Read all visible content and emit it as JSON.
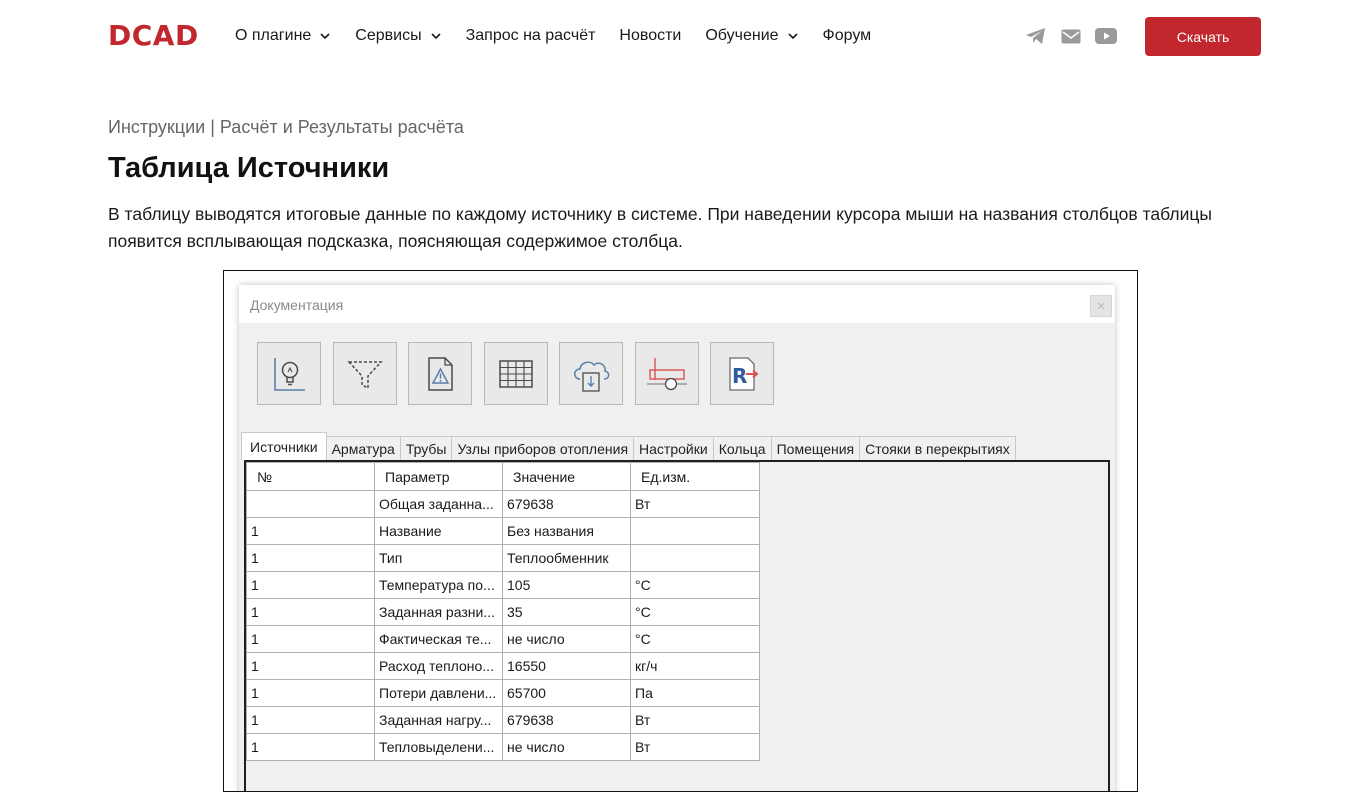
{
  "header": {
    "logo": "DCAD",
    "nav": [
      {
        "label": "О плагине",
        "dropdown": true
      },
      {
        "label": "Сервисы",
        "dropdown": true
      },
      {
        "label": "Запрос на расчёт",
        "dropdown": false
      },
      {
        "label": "Новости",
        "dropdown": false
      },
      {
        "label": "Обучение",
        "dropdown": true
      },
      {
        "label": "Форум",
        "dropdown": false
      }
    ],
    "social_icons": [
      "telegram-icon",
      "mail-icon",
      "youtube-icon"
    ],
    "download_label": "Скачать",
    "accent_color": "#c1272d"
  },
  "breadcrumb": "Инструкции | Расчёт и Результаты расчёта",
  "title": "Таблица Источники",
  "intro": "В таблицу выводятся итоговые данные по каждому источнику в системе. При наведении курсора мыши на названия столбцов таблицы появится всплывающая подсказка, поясняющая содержимое столбца.",
  "window": {
    "title": "Документация",
    "tools": [
      "lightbulb-chart-icon",
      "filter-icon",
      "warning-document-icon",
      "table-icon",
      "cloud-download-icon",
      "pipe-scheme-icon",
      "revit-export-icon"
    ],
    "tabs": [
      "Источники",
      "Арматура",
      "Трубы",
      "Узлы приборов отопления",
      "Настройки",
      "Кольца",
      "Помещения",
      "Стояки в перекрытиях"
    ],
    "active_tab": "Источники",
    "columns": [
      "№",
      "Параметр",
      "Значение",
      "Ед.изм."
    ],
    "rows": [
      [
        "",
        "Общая заданна...",
        "679638",
        "Вт"
      ],
      [
        "1",
        "Название",
        "Без названия",
        ""
      ],
      [
        "1",
        "Тип",
        "Теплообменник",
        ""
      ],
      [
        "1",
        "Температура по...",
        "105",
        "°С"
      ],
      [
        "1",
        "Заданная разни...",
        "35",
        "°С"
      ],
      [
        "1",
        "Фактическая те...",
        "не число",
        "°С"
      ],
      [
        "1",
        "Расход теплоно...",
        "16550",
        "кг/ч"
      ],
      [
        "1",
        "Потери давлени...",
        "65700",
        "Па"
      ],
      [
        "1",
        "Заданная нагру...",
        "679638",
        "Вт"
      ],
      [
        "1",
        "Тепловыделени...",
        "не число",
        "Вт"
      ]
    ]
  }
}
